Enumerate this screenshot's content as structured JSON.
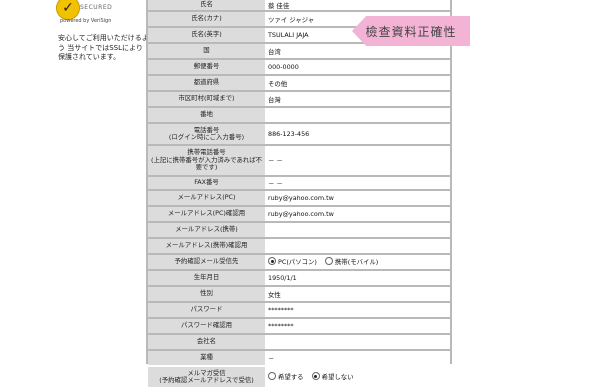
{
  "badge": {
    "check": "✓",
    "text": "SECURED",
    "powered": "powered by VeriSign"
  },
  "ssl_note": "安心してご利用いただけるよう 当サイトではSSLにより 保護されています。",
  "tag": "檢查資料正確性",
  "rows": [
    {
      "label": "氏名",
      "value": "蔡 佳佳"
    },
    {
      "label": "氏名(カナ)",
      "value": "ツァイ ジャジャ"
    },
    {
      "label": "氏名(英字)",
      "value": "TSULALI JAJA"
    },
    {
      "label": "国",
      "value": "台湾"
    },
    {
      "label": "郵便番号",
      "value": "000-0000"
    },
    {
      "label": "都道府県",
      "value": "その他"
    },
    {
      "label": "市区町村(町域まで)",
      "value": "台灣"
    },
    {
      "label": "番地",
      "value": ""
    },
    {
      "label": "電話番号\n(ログイン時にご入力番号)",
      "value": "886-123-456"
    },
    {
      "label": "携帯電話番号\n(上記に携帯番号が入力済みであれば不要です)",
      "value": "－ －"
    },
    {
      "label": "FAX番号",
      "value": "－ －"
    },
    {
      "label": "メールアドレス(PC)",
      "value": "ruby@yahoo.com.tw"
    },
    {
      "label": "メールアドレス(PC)確認用",
      "value": "ruby@yahoo.com.tw"
    },
    {
      "label": "メールアドレス(携帯)",
      "value": ""
    },
    {
      "label": "メールアドレス(携帯)確認用",
      "value": ""
    },
    {
      "label": "予約確認メール受信先",
      "value": ""
    },
    {
      "label": "生年月日",
      "value": "1950/1/1"
    },
    {
      "label": "性別",
      "value": "女性"
    },
    {
      "label": "パスワード",
      "value": "********"
    },
    {
      "label": "パスワード確認用",
      "value": "********"
    },
    {
      "label": "会社名",
      "value": ""
    },
    {
      "label": "業種",
      "value": "－"
    },
    {
      "label": "メルマガ受信\n(予約確認メールアドレスで受信)",
      "value": ""
    }
  ],
  "reservation_radio": {
    "pc": "PC(パソコン)",
    "mobile": "携帯(モバイル)"
  },
  "newsletter_radio": {
    "yes": "希望する",
    "no": "希望しない"
  }
}
